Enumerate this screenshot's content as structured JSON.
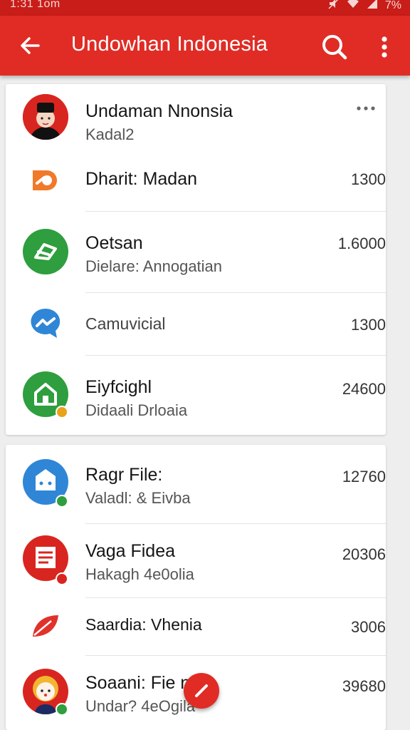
{
  "status_bar": {
    "time": "1:31 1om",
    "battery": "7%"
  },
  "app_bar": {
    "title": "Undowhan Indonesia"
  },
  "section1": {
    "header": {
      "primary": "Undaman Nnonsia",
      "secondary": "Kadal2"
    },
    "rows": [
      {
        "primary": "Dharit: Madan",
        "value": "1300"
      },
      {
        "primary": "Oetsan",
        "secondary": "Dielare: Annogatian",
        "value": "1.6000"
      },
      {
        "primary": "Camuvicial",
        "value": "1300"
      },
      {
        "primary": "Eiyfcighl",
        "secondary": "Didaali Drloaia",
        "value": "24600"
      }
    ]
  },
  "section2": {
    "rows": [
      {
        "primary": "Ragr File:",
        "secondary": "Valadl: & Eivba",
        "value": "12760"
      },
      {
        "primary": "Vaga Fidea",
        "secondary": "Hakagh 4e0olia",
        "value": "20306"
      },
      {
        "primary": "Saardia: Vhenia",
        "value": "3006"
      },
      {
        "primary": "Soaani: Fie  nt",
        "secondary": "Undar? 4eOgila",
        "value": "39680"
      }
    ]
  },
  "colors": {
    "appbar": "#e02c25",
    "statusbar": "#c81d18",
    "accent_green": "#2e9e3e",
    "accent_blue": "#2f86d6",
    "accent_orange": "#f07a2a"
  },
  "icons": [
    "arrow-back-icon",
    "search-icon",
    "more-vert-icon",
    "overflow-dots-icon",
    "edit-icon"
  ]
}
